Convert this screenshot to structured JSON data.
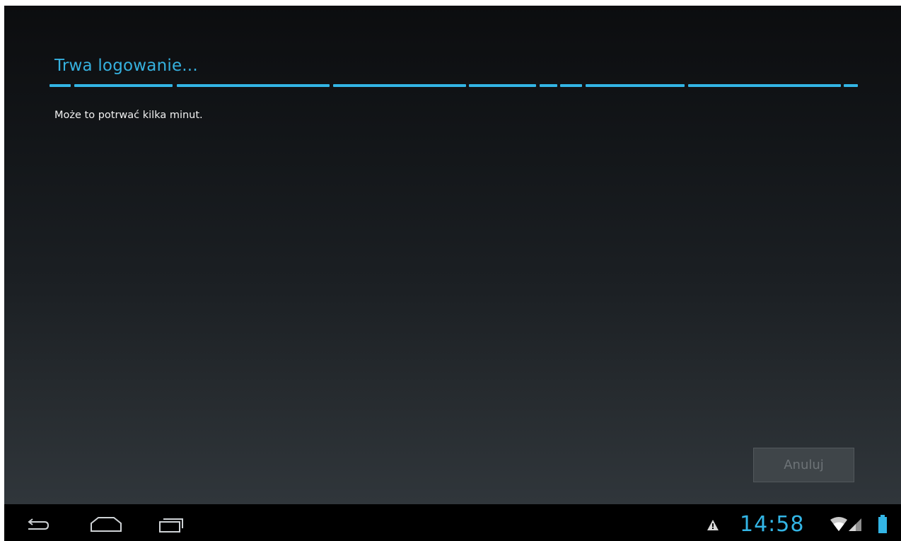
{
  "dialog": {
    "title": "Trwa logowanie...",
    "message": "Może to potrwać kilka minut.",
    "cancel_label": "Anuluj",
    "accent_color": "#33b5e5"
  },
  "statusbar": {
    "time": "14:58",
    "icons": [
      "warning-icon",
      "wifi-icon",
      "signal-icon",
      "battery-icon"
    ]
  },
  "navbar": {
    "buttons": [
      "back-icon",
      "home-icon",
      "recent-apps-icon"
    ]
  }
}
